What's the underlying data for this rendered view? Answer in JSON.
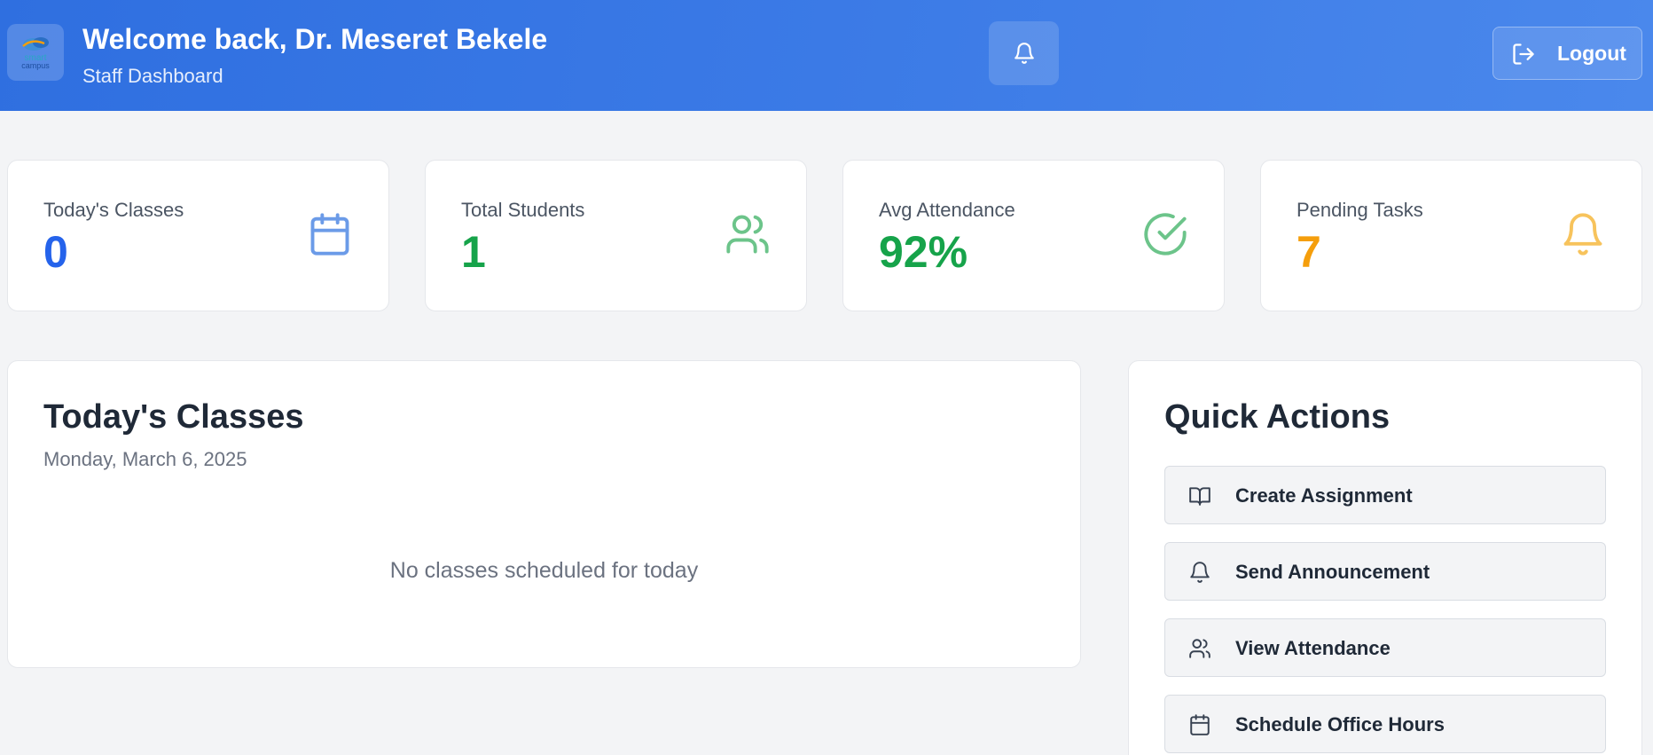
{
  "header": {
    "welcome": "Welcome back, Dr. Meseret Bekele",
    "subtitle": "Staff Dashboard",
    "logo_text_1": "smart",
    "logo_text_2": "campus",
    "logout_label": "Logout",
    "colors": {
      "gradient_start": "#2f6fe0",
      "gradient_end": "#4a88ec"
    }
  },
  "stats": [
    {
      "label": "Today's Classes",
      "value": "0",
      "color": "#2563eb",
      "icon": "calendar-icon"
    },
    {
      "label": "Total Students",
      "value": "1",
      "color": "#16a34a",
      "icon": "users-icon"
    },
    {
      "label": "Avg Attendance",
      "value": "92%",
      "color": "#16a34a",
      "icon": "check-circle-icon"
    },
    {
      "label": "Pending Tasks",
      "value": "7",
      "color": "#f59e0b",
      "icon": "bell-icon"
    }
  ],
  "classes": {
    "title": "Today's Classes",
    "date": "Monday, March 6, 2025",
    "empty_message": "No classes scheduled for today"
  },
  "quick_actions": {
    "title": "Quick Actions",
    "items": [
      {
        "label": "Create Assignment",
        "icon": "book-open-icon"
      },
      {
        "label": "Send Announcement",
        "icon": "bell-icon"
      },
      {
        "label": "View Attendance",
        "icon": "users-icon"
      },
      {
        "label": "Schedule Office Hours",
        "icon": "calendar-icon"
      }
    ]
  }
}
